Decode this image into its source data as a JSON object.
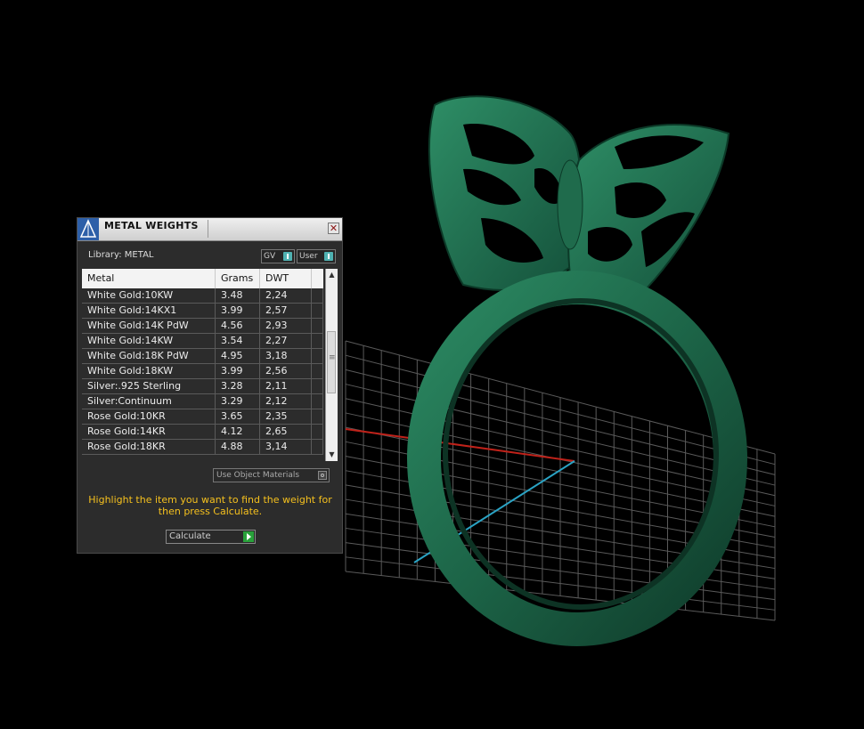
{
  "panel": {
    "title": "METAL WEIGHTS",
    "close_icon": "close-icon",
    "library_label": "Library: METAL",
    "toggles": [
      {
        "label": "GV"
      },
      {
        "label": "User"
      }
    ],
    "table": {
      "headers": [
        "Metal",
        "Grams",
        "DWT"
      ],
      "rows": [
        {
          "metal": "White Gold:10KW",
          "grams": "3.48",
          "dwt": "2,24"
        },
        {
          "metal": "White Gold:14KX1",
          "grams": "3.99",
          "dwt": "2,57"
        },
        {
          "metal": "White Gold:14K PdW",
          "grams": "4.56",
          "dwt": "2,93"
        },
        {
          "metal": "White Gold:14KW",
          "grams": "3.54",
          "dwt": "2,27"
        },
        {
          "metal": "White Gold:18K PdW",
          "grams": "4.95",
          "dwt": "3,18"
        },
        {
          "metal": "White Gold:18KW",
          "grams": "3.99",
          "dwt": "2,56"
        },
        {
          "metal": "Silver:.925 Sterling",
          "grams": "3.28",
          "dwt": "2,11"
        },
        {
          "metal": "Silver:Continuum",
          "grams": "3.29",
          "dwt": "2,12"
        },
        {
          "metal": "Rose Gold:10KR",
          "grams": "3.65",
          "dwt": "2,35"
        },
        {
          "metal": "Rose Gold:14KR",
          "grams": "4.12",
          "dwt": "2,65"
        },
        {
          "metal": "Rose Gold:18KR",
          "grams": "4.88",
          "dwt": "3,14"
        }
      ]
    },
    "use_object_materials": "Use Object Materials",
    "instructions": "Highlight the item you want to find the weight for then press Calculate.",
    "calculate_label": "Calculate"
  },
  "colors": {
    "ring_green": "#1e6a4a",
    "instruction_text": "#f5c01e",
    "toggle_accent": "#4fb2b2",
    "go_button": "#28a13a",
    "axis_x": "#c0221a",
    "axis_z": "#2aa3c4"
  }
}
